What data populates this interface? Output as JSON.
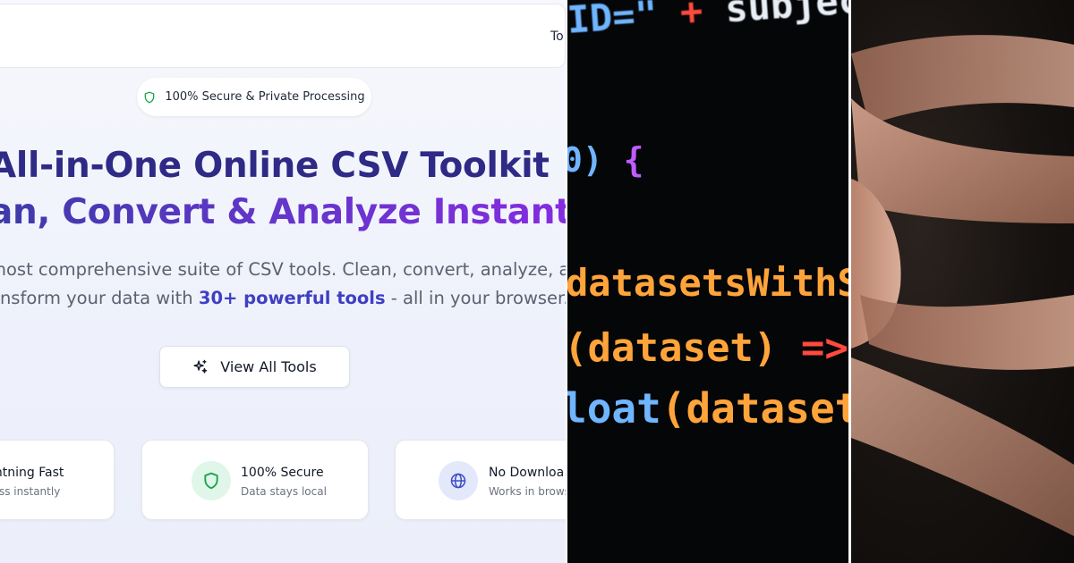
{
  "website": {
    "nav_partial": "To",
    "badge": "100% Secure & Private Processing",
    "hero_line1": "All-in-One Online CSV Toolkit",
    "hero_line2": "an, Convert & Analyze Instantly",
    "subtitle_line1": "most comprehensive suite of CSV tools. Clean, convert, analyze, and",
    "subtitle_line2_start": "ansform your data with ",
    "subtitle_highlight": "30+ powerful tools",
    "subtitle_line2_end": " - all in your browser.",
    "cta_label": "View All Tools",
    "features": [
      {
        "title": "ghtning Fast",
        "desc": "cess instantly",
        "icon": "lightning-icon"
      },
      {
        "title": "100% Secure",
        "desc": "Data stays local",
        "icon": "shield-icon"
      },
      {
        "title": "No Downloa",
        "desc": "Works in brows",
        "icon": "globe-icon"
      }
    ]
  },
  "code_photo": {
    "line1_a": "ID=\"",
    "line1_b": " + ",
    "line1_c": "subject",
    "line2_a": " 0) ",
    "line2_b": "{",
    "line3": "datasetsWithSu",
    "line4_a": "(dataset)",
    "line4_b": " => ",
    "line4_c": "{",
    "line5_a": "loat",
    "line5_b": "(dataset",
    "line5_c": "[\""
  },
  "colors": {
    "brand_indigo": "#2e2a85",
    "brand_purple": "#8a2be2",
    "highlight": "#3f3fc3",
    "secure_green": "#16a34a"
  }
}
